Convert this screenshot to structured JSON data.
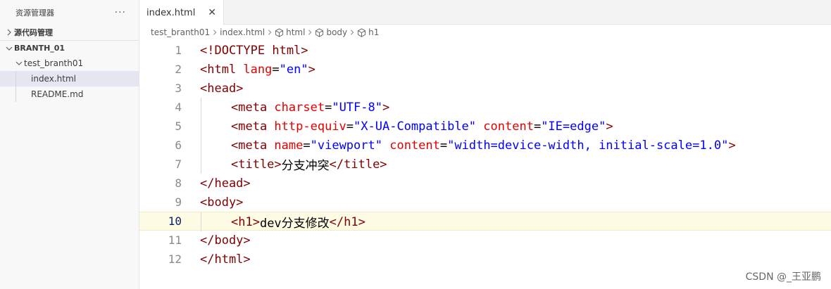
{
  "sidebar": {
    "title": "资源管理器",
    "more": "···",
    "scm_section": "源代码管理",
    "workspace_section": "BRANTH_01",
    "folder": "test_branth01",
    "files": [
      "index.html",
      "README.md"
    ]
  },
  "tabs": [
    {
      "label": "index.html",
      "close": "✕"
    }
  ],
  "breadcrumb": {
    "items": [
      "test_branth01",
      "index.html",
      "html",
      "body",
      "h1"
    ]
  },
  "editor": {
    "line_numbers": [
      "1",
      "2",
      "3",
      "4",
      "5",
      "6",
      "7",
      "8",
      "9",
      "10",
      "11",
      "12"
    ],
    "current_line": "10",
    "lines": [
      [
        {
          "t": "t-tag",
          "v": "<!DOCTYPE html>"
        }
      ],
      [
        {
          "t": "t-tag",
          "v": "<html "
        },
        {
          "t": "t-attr",
          "v": "lang"
        },
        {
          "t": "t-text",
          "v": "="
        },
        {
          "t": "t-val",
          "v": "\"en\""
        },
        {
          "t": "t-tag",
          "v": ">"
        }
      ],
      [
        {
          "t": "t-tag",
          "v": "<head>"
        }
      ],
      [
        {
          "t": "t-tag",
          "v": "<meta "
        },
        {
          "t": "t-attr",
          "v": "charset"
        },
        {
          "t": "t-text",
          "v": "="
        },
        {
          "t": "t-val",
          "v": "\"UTF-8\""
        },
        {
          "t": "t-tag",
          "v": ">"
        }
      ],
      [
        {
          "t": "t-tag",
          "v": "<meta "
        },
        {
          "t": "t-attr",
          "v": "http-equiv"
        },
        {
          "t": "t-text",
          "v": "="
        },
        {
          "t": "t-val",
          "v": "\"X-UA-Compatible\""
        },
        {
          "t": "t-text",
          "v": " "
        },
        {
          "t": "t-attr",
          "v": "content"
        },
        {
          "t": "t-text",
          "v": "="
        },
        {
          "t": "t-val",
          "v": "\"IE=edge\""
        },
        {
          "t": "t-tag",
          "v": ">"
        }
      ],
      [
        {
          "t": "t-tag",
          "v": "<meta "
        },
        {
          "t": "t-attr",
          "v": "name"
        },
        {
          "t": "t-text",
          "v": "="
        },
        {
          "t": "t-val",
          "v": "\"viewport\""
        },
        {
          "t": "t-text",
          "v": " "
        },
        {
          "t": "t-attr",
          "v": "content"
        },
        {
          "t": "t-text",
          "v": "="
        },
        {
          "t": "t-val",
          "v": "\"width=device-width, initial-scale=1.0\""
        },
        {
          "t": "t-tag",
          "v": ">"
        }
      ],
      [
        {
          "t": "t-tag",
          "v": "<title>"
        },
        {
          "t": "t-text",
          "v": "分支冲突"
        },
        {
          "t": "t-tag",
          "v": "</title>"
        }
      ],
      [
        {
          "t": "t-tag",
          "v": "</head>"
        }
      ],
      [
        {
          "t": "t-tag",
          "v": "<body>"
        }
      ],
      [
        {
          "t": "t-tag",
          "v": "<h1>"
        },
        {
          "t": "t-text",
          "v": "dev分支修改"
        },
        {
          "t": "t-tag",
          "v": "</h1>"
        }
      ],
      [
        {
          "t": "t-tag",
          "v": "</body>"
        }
      ],
      [
        {
          "t": "t-tag",
          "v": "</html>"
        }
      ]
    ],
    "indent_levels": [
      0,
      0,
      0,
      1,
      1,
      1,
      1,
      0,
      0,
      1,
      0,
      0
    ]
  },
  "watermark": "CSDN @_王亚鹏"
}
